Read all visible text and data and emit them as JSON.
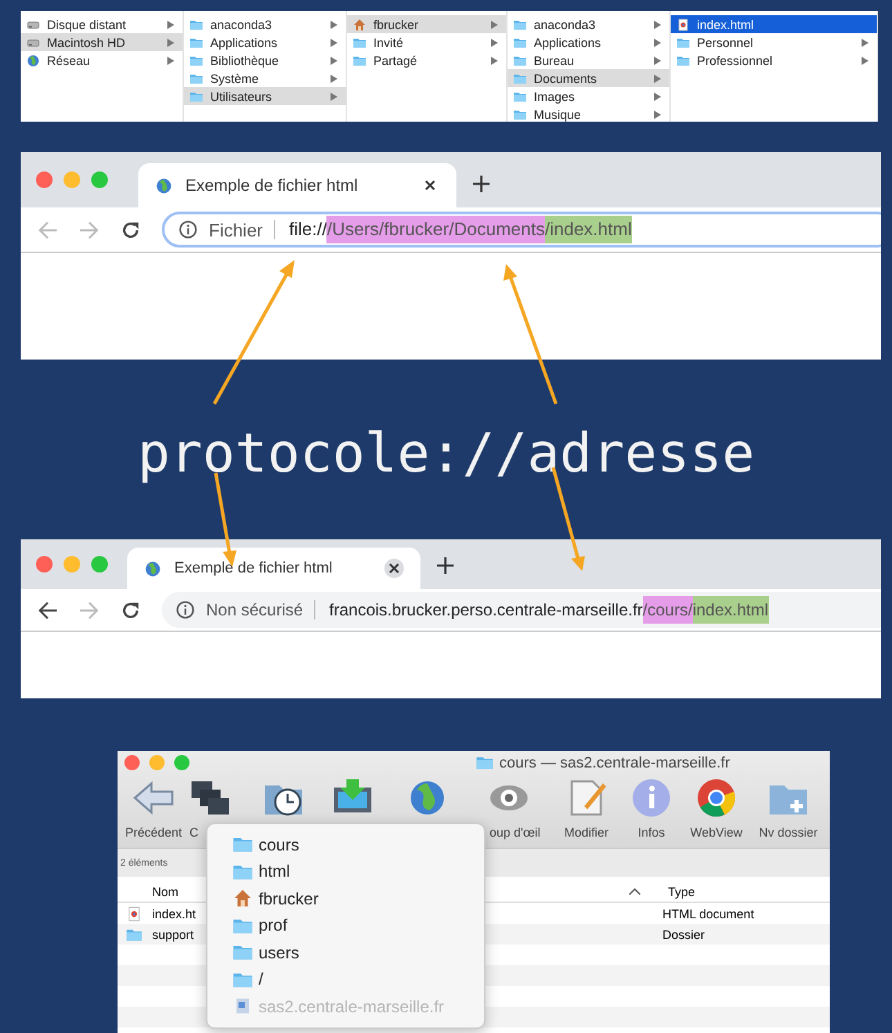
{
  "finder_columns": [
    {
      "active": false,
      "items": [
        {
          "label": "Disque distant",
          "kind": "disk",
          "selected": false,
          "has_children": true
        },
        {
          "label": "Macintosh HD",
          "kind": "disk",
          "selected": true,
          "has_children": true
        },
        {
          "label": "Réseau",
          "kind": "globe",
          "selected": false,
          "has_children": true
        }
      ]
    },
    {
      "active": false,
      "items": [
        {
          "label": "anaconda3",
          "kind": "folder",
          "selected": false,
          "has_children": true
        },
        {
          "label": "Applications",
          "kind": "folder",
          "selected": false,
          "has_children": true
        },
        {
          "label": "Bibliothèque",
          "kind": "folder",
          "selected": false,
          "has_children": true
        },
        {
          "label": "Système",
          "kind": "folder",
          "selected": false,
          "has_children": true
        },
        {
          "label": "Utilisateurs",
          "kind": "folder",
          "selected": true,
          "has_children": true
        }
      ]
    },
    {
      "active": false,
      "items": [
        {
          "label": "fbrucker",
          "kind": "home",
          "selected": true,
          "has_children": true
        },
        {
          "label": "Invité",
          "kind": "folder",
          "selected": false,
          "has_children": true
        },
        {
          "label": "Partagé",
          "kind": "folder",
          "selected": false,
          "has_children": true
        }
      ]
    },
    {
      "active": false,
      "items": [
        {
          "label": "anaconda3",
          "kind": "folder",
          "selected": false,
          "has_children": true
        },
        {
          "label": "Applications",
          "kind": "folder",
          "selected": false,
          "has_children": true
        },
        {
          "label": "Bureau",
          "kind": "folder",
          "selected": false,
          "has_children": true
        },
        {
          "label": "Documents",
          "kind": "folder",
          "selected": true,
          "has_children": true
        },
        {
          "label": "Images",
          "kind": "folder",
          "selected": false,
          "has_children": true
        },
        {
          "label": "Musique",
          "kind": "folder",
          "selected": false,
          "has_children": true
        }
      ]
    },
    {
      "active": true,
      "items": [
        {
          "label": "index.html",
          "kind": "file",
          "selected": true,
          "has_children": false
        },
        {
          "label": "Personnel",
          "kind": "folder",
          "selected": false,
          "has_children": true
        },
        {
          "label": "Professionnel",
          "kind": "folder",
          "selected": false,
          "has_children": true
        }
      ]
    }
  ],
  "browsers": [
    {
      "tab_title": "Exemple de fichier html",
      "back_disabled": true,
      "forward_disabled": true,
      "omnibox_focused": true,
      "security_label": "Fichier",
      "url": [
        {
          "text": "file://"
        },
        {
          "text": "/Users/fbrucker/Documents",
          "color": "#e59ce9"
        },
        {
          "text": "/index.html",
          "color": "#a9cf8c"
        }
      ]
    },
    {
      "tab_title": "Exemple de fichier html",
      "back_disabled": false,
      "forward_disabled": true,
      "omnibox_focused": false,
      "security_label": "Non sécurisé",
      "url": [
        {
          "text": "francois.brucker.perso.centrale-marseille.fr"
        },
        {
          "text": "/cours/",
          "color": "#e59ce9"
        },
        {
          "text": "index.html",
          "color": "#a9cf8c"
        }
      ]
    }
  ],
  "caption": "protocole://adresse",
  "ftp_window": {
    "title": "cours — sas2.centrale-marseille.fr",
    "toolbar": [
      {
        "kind": "back",
        "label": "Précédent"
      },
      {
        "kind": "stack",
        "label": "C"
      },
      {
        "kind": "clock"
      },
      {
        "kind": "monitor"
      },
      {
        "kind": "globe"
      },
      {
        "kind": "eye",
        "label": "oup d'œil"
      },
      {
        "kind": "doc",
        "label": "Modifier"
      },
      {
        "kind": "info",
        "label": "Infos"
      },
      {
        "kind": "ring",
        "label": "WebView"
      },
      {
        "kind": "newfolder",
        "label": "Nv dossier"
      }
    ],
    "status": "2 éléments",
    "columns": [
      "Nom",
      "Type"
    ],
    "rows": [
      {
        "kind": "file",
        "name": "index.ht",
        "type": "HTML document"
      },
      {
        "kind": "folder",
        "name": "support",
        "type": "Dossier"
      }
    ],
    "path_menu": [
      {
        "kind": "folder",
        "label": "cours",
        "disabled": false
      },
      {
        "kind": "folder",
        "label": "html",
        "disabled": false
      },
      {
        "kind": "home",
        "label": "fbrucker",
        "disabled": false
      },
      {
        "kind": "folder",
        "label": "prof",
        "disabled": false
      },
      {
        "kind": "folder",
        "label": "users",
        "disabled": false
      },
      {
        "kind": "folder",
        "label": "/",
        "disabled": false
      },
      {
        "kind": "server",
        "label": "sas2.centrale-marseille.fr",
        "disabled": true
      }
    ]
  }
}
